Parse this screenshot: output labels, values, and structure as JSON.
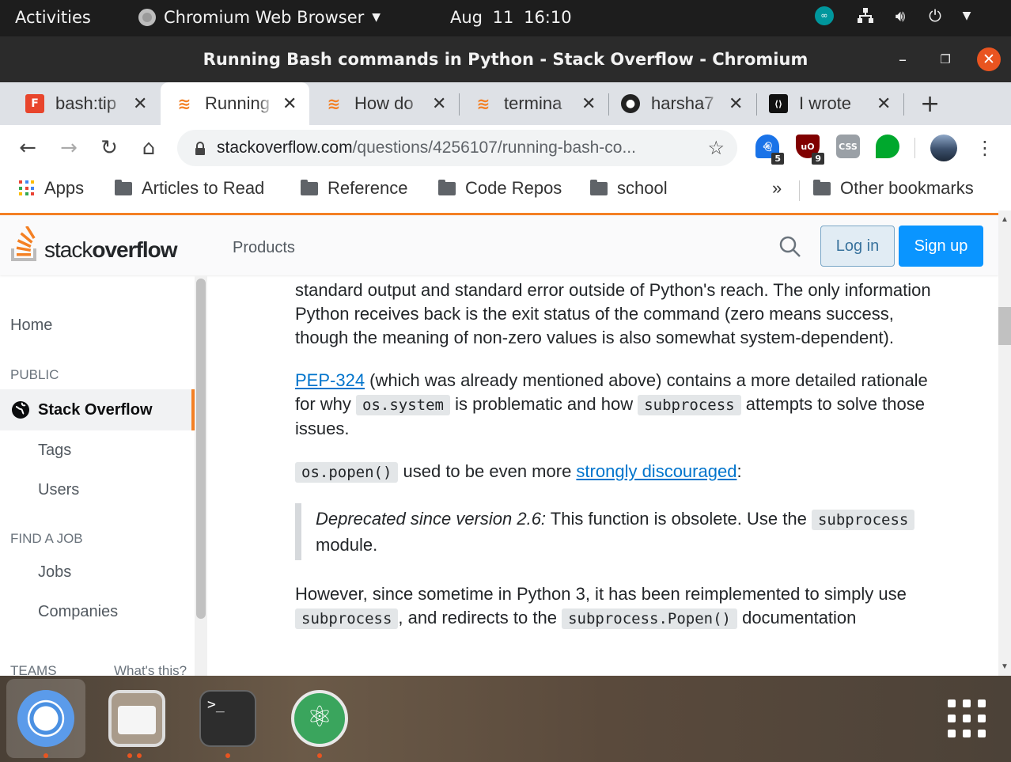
{
  "system_bar": {
    "activities": "Activities",
    "app_name": "Chromium Web Browser",
    "clock": "Aug 11  16:10"
  },
  "window": {
    "title": "Running Bash commands in Python - Stack Overflow - Chromium"
  },
  "tabs": [
    {
      "label": "bash:tip",
      "icon": "f-icon",
      "active": false
    },
    {
      "label": "Running",
      "icon": "stackoverflow-icon",
      "active": true
    },
    {
      "label": "How do",
      "icon": "stackoverflow-icon",
      "active": false
    },
    {
      "label": "termina",
      "icon": "stackoverflow-icon",
      "active": false
    },
    {
      "label": "harsha7",
      "icon": "github-icon",
      "active": false
    },
    {
      "label": "I wrote",
      "icon": "dev-icon",
      "active": false
    }
  ],
  "toolbar": {
    "url_host": "stackoverflow.com",
    "url_path": "/questions/4256107/running-bash-co...",
    "extensions": [
      {
        "name": "ghost-extension",
        "badge": "5",
        "color": "#1a73e8"
      },
      {
        "name": "ublock-extension",
        "badge": "9",
        "color": "#800000"
      },
      {
        "name": "css-extension",
        "badge": "",
        "color": "#9aa0a6"
      },
      {
        "name": "evernote-extension",
        "badge": "",
        "color": "#00a82d"
      }
    ]
  },
  "bookmarks": {
    "apps": "Apps",
    "folders": [
      "Articles to Read",
      "Reference",
      "Code Repos",
      "school"
    ],
    "overflow": "»",
    "other": "Other bookmarks"
  },
  "so_header": {
    "logo_light": "stack",
    "logo_bold": "overflow",
    "products": "Products",
    "login": "Log in",
    "signup": "Sign up"
  },
  "left_nav": {
    "home": "Home",
    "public": "PUBLIC",
    "stack_overflow": "Stack Overflow",
    "tags": "Tags",
    "users": "Users",
    "find_a_job": "FIND A JOB",
    "jobs": "Jobs",
    "companies": "Companies",
    "teams": "TEAMS",
    "whats_this": "What's this?"
  },
  "content": {
    "p1": "standard output and standard error outside of Python's reach. The only information Python receives back is the exit status of the command (zero means success, though the meaning of non-zero values is also somewhat system-dependent).",
    "p2_link": "PEP-324",
    "p2_a": " (which was already mentioned above) contains a more detailed rationale for why ",
    "p2_code1": "os.system",
    "p2_b": " is problematic and how ",
    "p2_code2": "subprocess",
    "p2_c": " attempts to solve those issues.",
    "p3_code": "os.popen()",
    "p3_a": " used to be even more ",
    "p3_link": "strongly discouraged",
    "p3_b": ":",
    "quote_em": "Deprecated since version 2.6:",
    "quote_a": " This function is obsolete. Use the ",
    "quote_code": "subprocess",
    "quote_b": " module.",
    "p4_a": "However, since sometime in Python 3, it has been reimplemented to simply use ",
    "p4_code1": "subprocess",
    "p4_b": ", and redirects to the ",
    "p4_code2": "subprocess.Popen()",
    "p4_c": " documentation"
  },
  "colors": {
    "so_orange": "#f48024",
    "link_blue": "#0074cc",
    "signup_blue": "#0a95ff",
    "ubuntu_orange": "#e95420"
  },
  "dock": [
    "chromium-icon",
    "files-icon",
    "terminal-icon",
    "atom-icon",
    "show-apps-icon"
  ]
}
